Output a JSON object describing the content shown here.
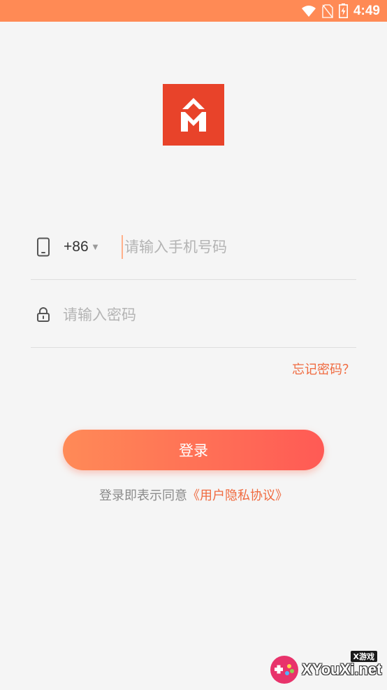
{
  "status_bar": {
    "time": "4:49",
    "icons": [
      "wifi-icon",
      "no-sim-icon",
      "battery-charging-icon"
    ],
    "background": "#ff8a55"
  },
  "logo": {
    "icon": "house-logo-icon",
    "color": "#e8432a"
  },
  "phone": {
    "country_code": "+86",
    "placeholder": "请输入手机号码",
    "value": ""
  },
  "password": {
    "placeholder": "请输入密码",
    "value": ""
  },
  "forgot_password": "忘记密码？",
  "login_button": "登录",
  "agreement": {
    "prefix": "登录即表示同意",
    "link": "《用户隐私协议》"
  },
  "watermark": {
    "tag": "X游戏",
    "text": "XYouXi.net"
  },
  "colors": {
    "accent": "#f06a3f",
    "button_gradient_start": "#ff8a57",
    "button_gradient_end": "#ff5a55"
  }
}
